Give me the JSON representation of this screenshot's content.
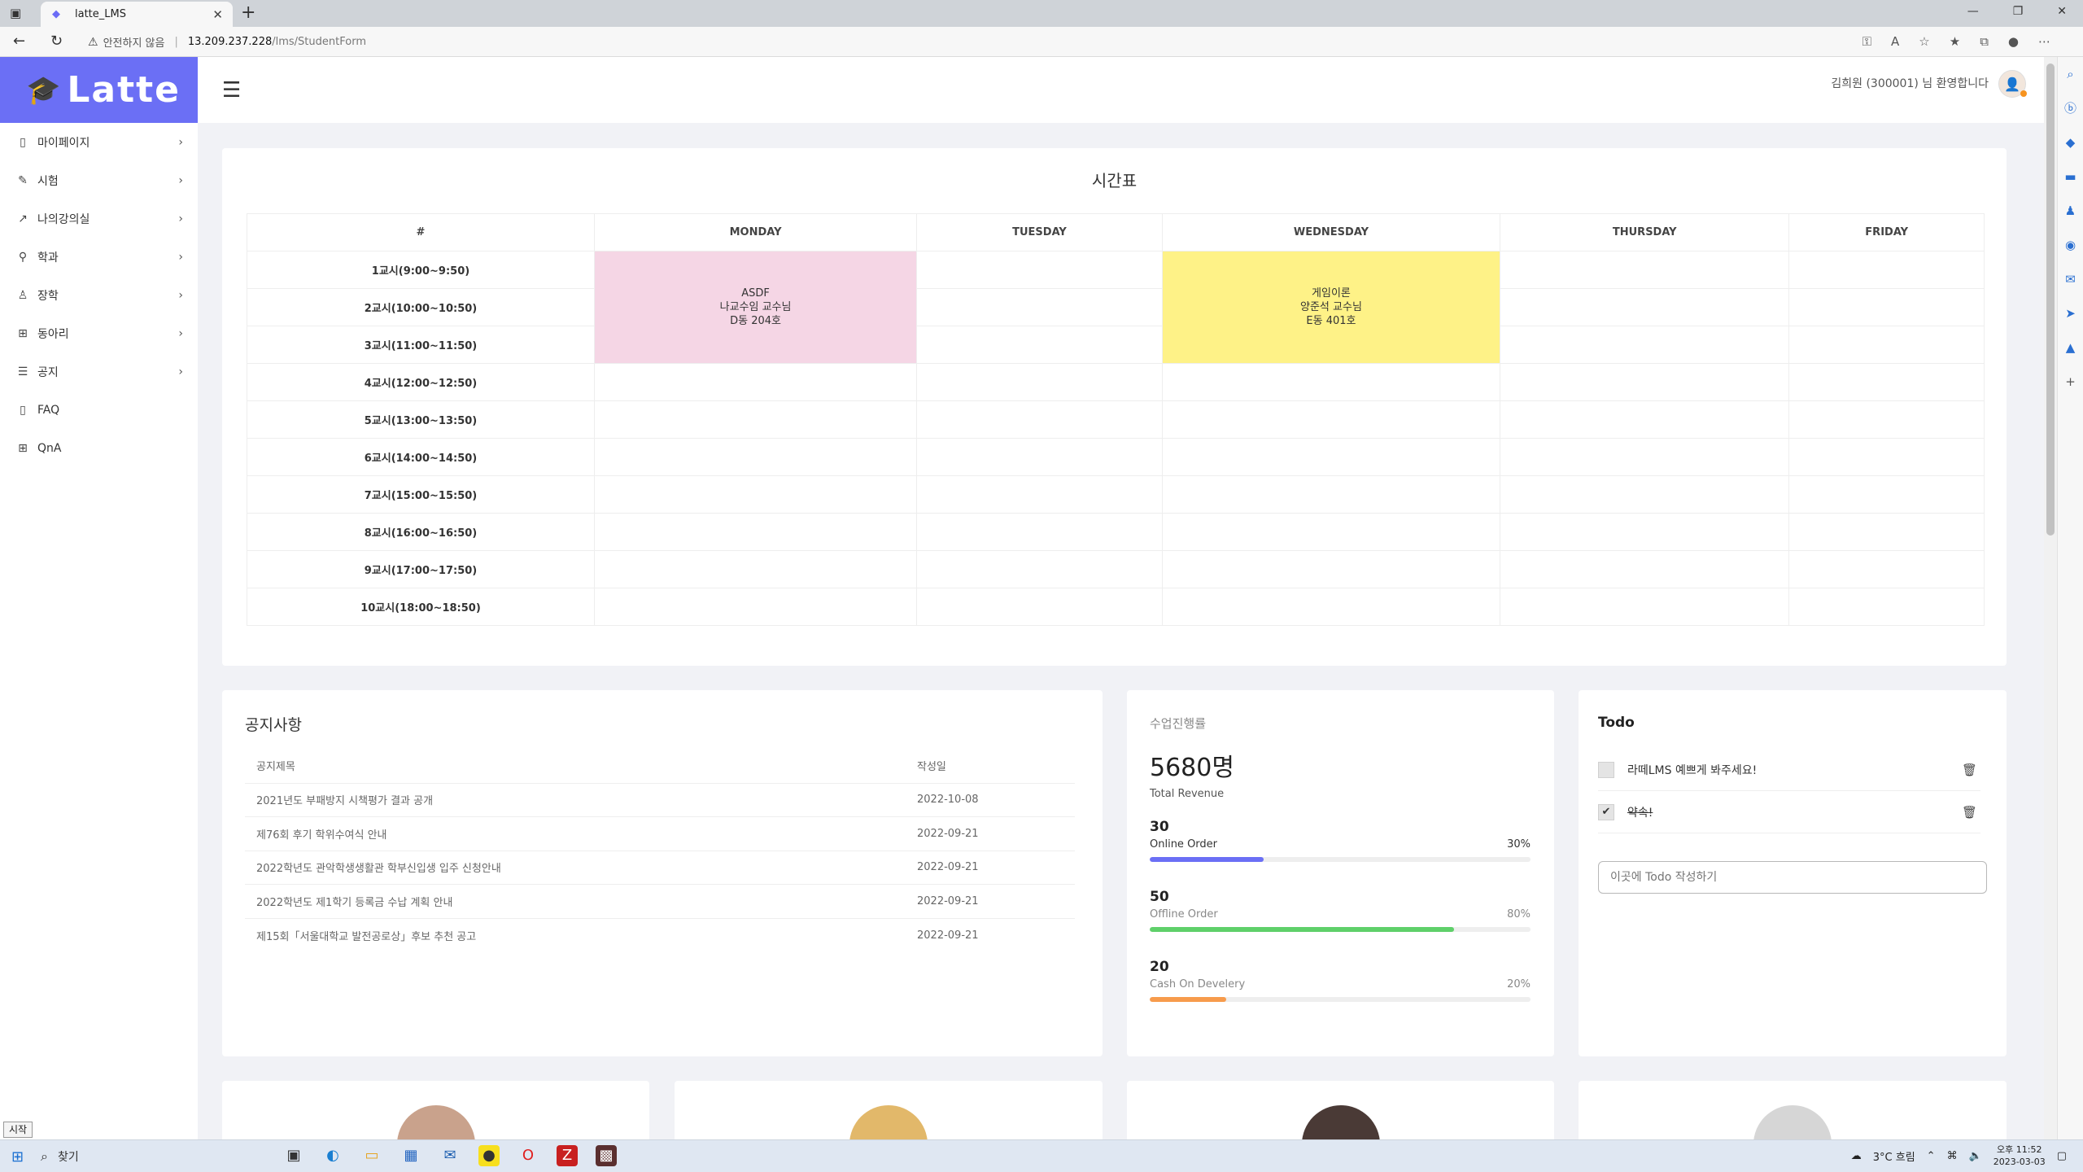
{
  "browser": {
    "tab_title": "latte_LMS",
    "url_warning": "안전하지 않음",
    "url_host": "13.209.237.228",
    "url_path": "/lms/StudentForm"
  },
  "app": {
    "logo": "Latte",
    "welcome": "김희원 (300001) 님 환영합니다",
    "sidebar": [
      {
        "label": "마이페이지",
        "icon": "page-icon",
        "chevron": true
      },
      {
        "label": "시험",
        "icon": "pencil-icon",
        "chevron": true
      },
      {
        "label": "나의강의실",
        "icon": "trend-icon",
        "chevron": true
      },
      {
        "label": "학과",
        "icon": "pin-icon",
        "chevron": true
      },
      {
        "label": "장학",
        "icon": "award-icon",
        "chevron": true
      },
      {
        "label": "동아리",
        "icon": "grid-icon",
        "chevron": true
      },
      {
        "label": "공지",
        "icon": "list-icon",
        "chevron": true
      },
      {
        "label": "FAQ",
        "icon": "doc-icon",
        "chevron": false
      },
      {
        "label": "QnA",
        "icon": "grid-icon",
        "chevron": false
      }
    ]
  },
  "timetable": {
    "title": "시간표",
    "headers": [
      "#",
      "MONDAY",
      "TUESDAY",
      "WEDNESDAY",
      "THURSDAY",
      "FRIDAY"
    ],
    "periods": [
      "1교시(9:00~9:50)",
      "2교시(10:00~10:50)",
      "3교시(11:00~11:50)",
      "4교시(12:00~12:50)",
      "5교시(13:00~13:50)",
      "6교시(14:00~14:50)",
      "7교시(15:00~15:50)",
      "8교시(16:00~16:50)",
      "9교시(17:00~17:50)",
      "10교시(18:00~18:50)"
    ],
    "monday_class": {
      "name": "ASDF",
      "professor": "나교수임 교수님",
      "room": "D동 204호",
      "color": "#f5d6e5"
    },
    "wednesday_class": {
      "name": "게임이론",
      "professor": "양준석 교수님",
      "room": "E동 401호",
      "color": "#fef287"
    }
  },
  "notice": {
    "title": "공지사항",
    "col_title": "공지제목",
    "col_date": "작성일",
    "rows": [
      {
        "title": "2021년도 부패방지 시책평가 결과 공개",
        "date": "2022-10-08"
      },
      {
        "title": "제76회 후기 학위수여식 안내",
        "date": "2022-09-21"
      },
      {
        "title": "2022학년도 관악학생생활관 학부신입생 입주 신청안내",
        "date": "2022-09-21"
      },
      {
        "title": "2022학년도 제1학기 등록금 수납 계획 안내",
        "date": "2022-09-21"
      },
      {
        "title": "제15회「서울대학교 발전공로상」후보 추천 공고",
        "date": "2022-09-21"
      }
    ]
  },
  "progress": {
    "title": "수업진행률",
    "big": "5680명",
    "sub": "Total Revenue",
    "items": [
      {
        "num": "30",
        "label": "Online Order",
        "pct_label": "30%",
        "pct": 30,
        "color": "#6b6ff5"
      },
      {
        "num": "50",
        "label": "Offline Order",
        "pct_label": "80%",
        "pct": 80,
        "color": "#5fd06a"
      },
      {
        "num": "20",
        "label": "Cash On Develery",
        "pct_label": "20%",
        "pct": 20,
        "color": "#f79b4c"
      }
    ]
  },
  "todo": {
    "title": "Todo",
    "items": [
      {
        "text": "라떼LMS 예쁘게 봐주세요!",
        "done": false
      },
      {
        "text": "약속!",
        "done": true
      }
    ],
    "placeholder": "이곳에 Todo 작성하기"
  },
  "taskbar": {
    "start_tip": "시작",
    "search": "찾기",
    "weather": "3°C  흐림",
    "time": "오후 11:52",
    "date": "2023-03-03"
  }
}
